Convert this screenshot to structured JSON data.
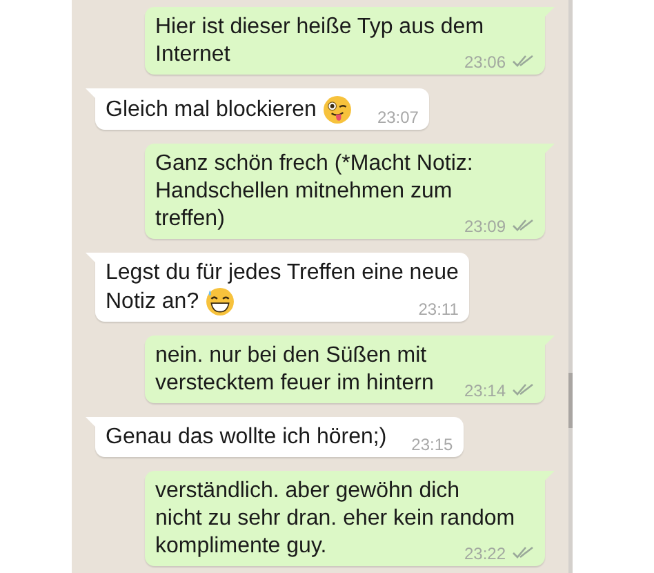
{
  "messages": [
    {
      "kind": "out",
      "text": "Hier ist dieser heiße Typ aus dem\nInternet",
      "time": "23:06",
      "ticks": true
    },
    {
      "kind": "in",
      "text": "Gleich mal blockieren",
      "emoji": {
        "kind": "wink_tongue"
      },
      "time": "23:07"
    },
    {
      "kind": "out",
      "text": "Ganz schön frech (*Macht Notiz:\nHandschellen mitnehmen zum\ntreffen)",
      "time": "23:09",
      "ticks": true
    },
    {
      "kind": "in",
      "text": "Legst du für jedes Treffen eine neue\nNotiz an?",
      "emoji": {
        "kind": "sweat_smile"
      },
      "time": "23:11"
    },
    {
      "kind": "out",
      "text": "nein. nur bei den Süßen mit\nverstecktem feuer im hintern",
      "time": "23:14",
      "ticks": true
    },
    {
      "kind": "in",
      "text": "Genau das wollte ich hören;)",
      "time": "23:15"
    },
    {
      "kind": "out",
      "text": "verständlich. aber gewöhn dich\nnicht zu sehr dran. eher kein random\nkomplimente guy.",
      "time": "23:22",
      "ticks": true
    }
  ]
}
